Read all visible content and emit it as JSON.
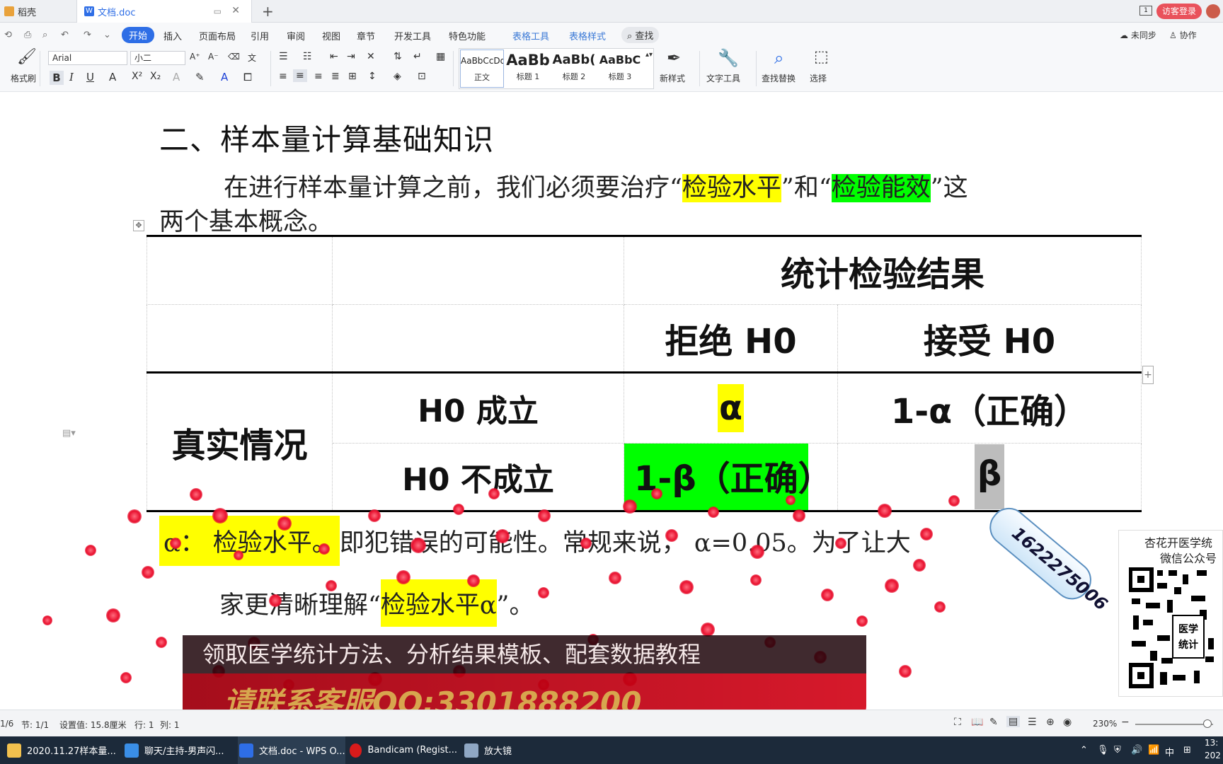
{
  "tabs": [
    {
      "label": "稻壳"
    },
    {
      "label": "文档.doc"
    }
  ],
  "window": {
    "login_label": "访客登录",
    "page_indicator": "1"
  },
  "menu": {
    "items": [
      "开始",
      "插入",
      "页面布局",
      "引用",
      "审阅",
      "视图",
      "章节",
      "开发工具",
      "特色功能",
      "表格工具",
      "表格样式"
    ],
    "search_label": "查找",
    "right": [
      "未同步",
      "协作"
    ]
  },
  "ribbon": {
    "format_painter": "格式刷",
    "font_name": "Arial",
    "font_size": "小二",
    "styles": [
      {
        "preview": "AaBbCcDd",
        "label": "正文"
      },
      {
        "preview": "AaBb",
        "label": "标题 1"
      },
      {
        "preview": "AaBb(",
        "label": "标题 2"
      },
      {
        "preview": "AaBbC",
        "label": "标题 3"
      }
    ],
    "new_style": "新样式",
    "text_tool": "文字工具",
    "find_replace": "查找替换",
    "select": "选择"
  },
  "document": {
    "heading": "二、样本量计算基础知识",
    "intro": {
      "pre": "在进行样本量计算之前，我们必须要治疗“",
      "hl1": "检验水平",
      "mid": "”和“",
      "hl2": "检验能效",
      "post": "”这",
      "line2": "两个基本概念。"
    },
    "table": {
      "header_top": "统计检验结果",
      "col_reject": "拒绝 H0",
      "col_accept": "接受 H0",
      "row_group": "真实情况",
      "row1_label": "H0 成立",
      "row1_reject": "α",
      "row1_accept": "1-α（正确）",
      "row2_label": "H0 不成立",
      "row2_reject": "1-β（正确）",
      "row2_accept": "β"
    },
    "alpha_line": {
      "hl": "α： 检验水平。",
      "rest": "即犯错误的可能性。常规来说， α=0.05。为了让大"
    },
    "alpha_line2": {
      "pre": "家更清晰理解“",
      "hl": "检验水平α",
      "post": "”。"
    }
  },
  "overlay": {
    "promo_line1": "领取医学统计方法、分析结果模板、配套数据教程",
    "promo_line2": "请联系客服QQ:3301888200",
    "qq_tag": "1622275006",
    "qr_title1": "杏花开医学统",
    "qr_title2": "微信公众号"
  },
  "status": {
    "page": "1/6",
    "section": "节: 1/1",
    "setting": "设置值: 15.8厘米",
    "row": "行: 1",
    "col": "列: 1",
    "zoom": "230%"
  },
  "taskbar": {
    "items": [
      "2020.11.27样本量...",
      "聊天/主持-男声闪...",
      "文档.doc - WPS O...",
      "Bandicam (Regist...",
      "放大镜"
    ],
    "ime": "中",
    "time": "13:",
    "date": "202"
  }
}
